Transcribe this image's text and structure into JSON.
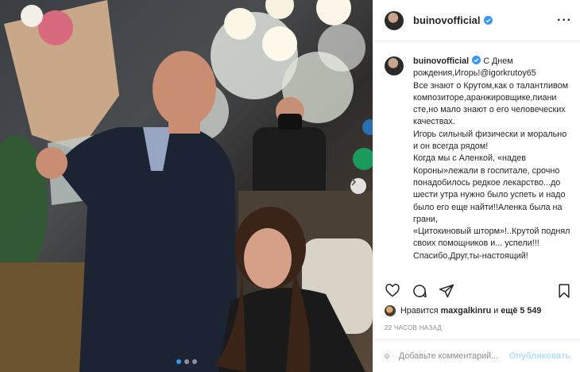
{
  "post": {
    "username": "buinovofficial",
    "caption_lines": [
      "С Днем рождения,Игорь!@igorkrutoy65",
      "Все знают о Крутом,как о талантливом композиторе,аранжировщике,пиани",
      "сте,но мало знают о его человеческих качествах.",
      "Игорь сильный физически и морально и он всегда рядом!",
      "Когда мы с Аленкой, «надев Короны»лежали в госпитале, срочно понадобилось редкое лекарство...до шести утра нужно было успеть и надо было его еще найти!!Аленка была на грани,",
      "«Цитокиновый шторм»!..Крутой поднял своих помощников и... успели!!!",
      "Спасибо,Друг,ты-настоящий!"
    ],
    "likes_prefix": "Нравится",
    "likes_user": "maxgalkinru",
    "likes_and": "и",
    "likes_more": "ещё 5 549",
    "timestamp": "22 ЧАСОВ НАЗАД",
    "comment_placeholder": "Добавьте комментарий...",
    "post_button": "Опубликовать"
  },
  "icons": {
    "more": "more-options-icon",
    "like": "heart-icon",
    "comment": "comment-icon",
    "share": "share-icon",
    "save": "bookmark-icon",
    "emoji": "smiley-icon",
    "verified": "verified-badge-icon",
    "next": "chevron-right-icon"
  },
  "colors": {
    "verified": "#3897f0",
    "post_button_disabled": "#b2dffc",
    "muted": "#8e8e8e",
    "text": "#262626"
  },
  "carousel": {
    "total": 3,
    "active": 1
  }
}
